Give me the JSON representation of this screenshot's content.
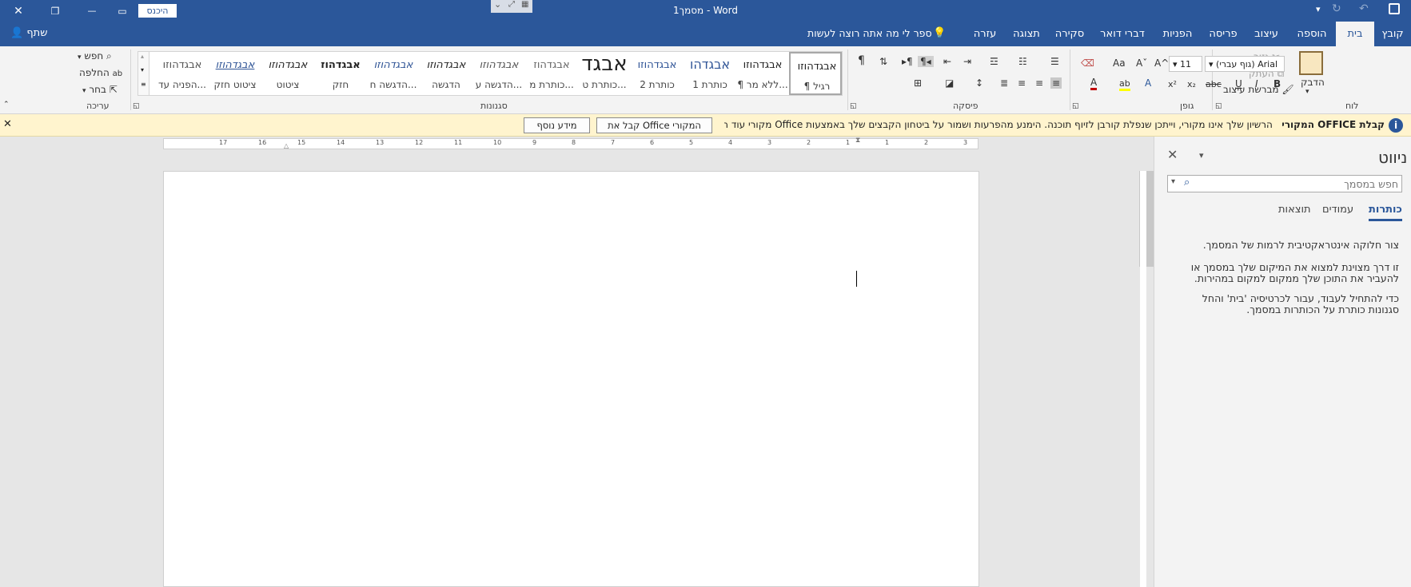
{
  "window": {
    "title": "מסמך1  -  Word",
    "signin_label": "היכנס",
    "minimize_glyph": "—",
    "restore_glyph": "❐",
    "close_glyph": "✕",
    "ribbon_display_glyph": "▭"
  },
  "tabs": [
    {
      "label": "קובץ"
    },
    {
      "label": "בית"
    },
    {
      "label": "הוספה"
    },
    {
      "label": "עיצוב"
    },
    {
      "label": "פריסה"
    },
    {
      "label": "הפניות"
    },
    {
      "label": "דברי דואר"
    },
    {
      "label": "סקירה"
    },
    {
      "label": "תצוגה"
    },
    {
      "label": "עזרה"
    }
  ],
  "tell_me": "ספר לי מה אתה רוצה לעשות",
  "share_label": "שתף",
  "ribbon": {
    "clipboard": {
      "group_label": "לוח",
      "paste_label": "הדבק",
      "cut_label": "גזור",
      "copy_label": "העתק",
      "format_painter_label": "מברשת עיצוב"
    },
    "font": {
      "group_label": "גופן",
      "font_name": "(גוף עברי) Arial",
      "font_size": "11",
      "bold": "B",
      "italic": "I",
      "underline": "U",
      "strike": "abc",
      "subscript": "x₂",
      "superscript": "x²",
      "grow": "A^",
      "shrink": "Aˇ",
      "case": "Aa",
      "font_color": "A",
      "highlight": "ab",
      "effects": "A"
    },
    "paragraph": {
      "group_label": "פיסקה",
      "show_marks": "¶"
    },
    "styles": {
      "group_label": "סגנונות",
      "items": [
        {
          "sample": "אבגדהוזו",
          "name": "¶ רגיל"
        },
        {
          "sample": "אבגדהוזו",
          "name": "¶ ללא מר..."
        },
        {
          "sample": "אבגדהו",
          "name": "כותרת 1"
        },
        {
          "sample": "אבגדהוזו",
          "name": "כותרת 2"
        },
        {
          "sample": "אבגד",
          "name": "כותרת ט..."
        },
        {
          "sample": "אבגדהוז",
          "name": "כותרת מ..."
        },
        {
          "sample": "אבגדהוזו",
          "name": "הדגשה ע..."
        },
        {
          "sample": "אבגדהוזו",
          "name": "הדגשה"
        },
        {
          "sample": "אבגדהוזו",
          "name": "הדגשה ח..."
        },
        {
          "sample": "אבגדהוז",
          "name": "חזק"
        },
        {
          "sample": "אבגדהוזו",
          "name": "ציטוט"
        },
        {
          "sample": "אבגדהוזו",
          "name": "ציטוט חזק"
        },
        {
          "sample": "אבגדהוזו",
          "name": "הפניה עד..."
        }
      ]
    },
    "editing": {
      "group_label": "עריכה",
      "find_label": "חפש",
      "replace_label": "החלפה",
      "select_label": "בחר"
    }
  },
  "infobar": {
    "title": "קבלת OFFICE המקורי",
    "message": "הרשיון שלך אינו מקורי, וייתכן שנפלת קורבן לזיוף תוכנה. הימנע מהפרעות ושמור על ביטחון הקבצים שלך באמצעות Office מקורי עוד היום.",
    "get_button": "קבל את Office המקורי",
    "more_button": "מידע נוסף"
  },
  "ruler": {
    "numbers": [
      "3",
      "2",
      "1",
      "1",
      "2",
      "3",
      "4",
      "5",
      "6",
      "7",
      "8",
      "9",
      "10",
      "11",
      "12",
      "13",
      "14",
      "15",
      "16",
      "17"
    ]
  },
  "nav_pane": {
    "title": "ניווט",
    "search_placeholder": "חפש במסמך",
    "tabs": [
      "כותרות",
      "עמודים",
      "תוצאות"
    ],
    "paragraphs": [
      "צור חלוקה אינטראקטיבית לרמות של המסמך.",
      "זו דרך מצוינת למצוא את המיקום שלך במסמך או להעביר את התוכן שלך ממקום למקום במהירות.",
      "כדי להתחיל לעבוד, עבור לכרטיסיה 'בית' והחל סגנונות כותרת על הכותרות במסמך."
    ]
  },
  "colors": {
    "accent": "#2b579a",
    "infobar_bg": "#fff4ce"
  }
}
